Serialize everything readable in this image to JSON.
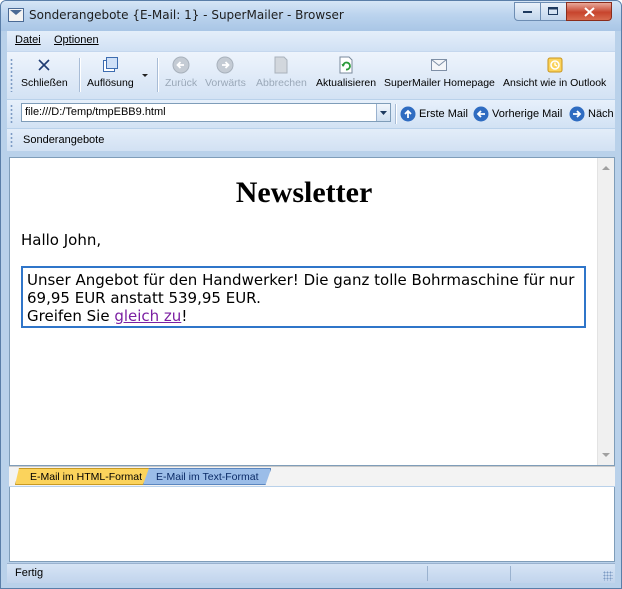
{
  "window": {
    "title": "Sonderangebote {E-Mail: 1} - SuperMailer - Browser"
  },
  "menu": {
    "items": [
      {
        "label": "Datei"
      },
      {
        "label": "Optionen"
      }
    ]
  },
  "toolbar": {
    "close_label": "Schließen",
    "resolution_label": "Auflösung",
    "back_label": "Zurück",
    "forward_label": "Vorwärts",
    "stop_label": "Abbrechen",
    "refresh_label": "Aktualisieren",
    "homepage_label": "SuperMailer Homepage",
    "outlook_label": "Ansicht wie in Outlook"
  },
  "address": {
    "value": "file:///D:/Temp/tmpEBB9.html",
    "first_label": "Erste Mail",
    "prev_label": "Vorherige Mail",
    "next_label": "Näch"
  },
  "breadcrumb": {
    "label": "Sonderangebote"
  },
  "content": {
    "heading": "Newsletter",
    "greeting": "Hallo John,",
    "offer_line1": "Unser Angebot für den Handwerker! Die ganz tolle Bohrmaschine für nur 69,95 EUR anstatt 539,95 EUR.",
    "offer_prefix": "Greifen Sie ",
    "offer_link": "gleich zu",
    "offer_suffix": "!"
  },
  "tabs": {
    "html_label": "E-Mail im HTML-Format",
    "text_label": "E-Mail im Text-Format",
    "active": "html"
  },
  "status": {
    "text": "Fertig"
  },
  "colors": {
    "link_visited": "#7b1fa2",
    "box_border": "#2f75c9",
    "tab_active": "#fbd35c",
    "tab_inactive": "#9bbde8"
  }
}
